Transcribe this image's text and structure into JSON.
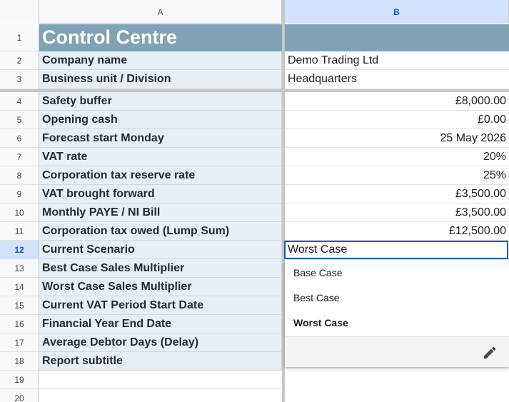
{
  "columns": {
    "a": "A",
    "b": "B"
  },
  "rows": [
    {
      "num": "1",
      "label": "Control Centre",
      "value": ""
    },
    {
      "num": "2",
      "label": "Company name",
      "value": "Demo Trading Ltd"
    },
    {
      "num": "3",
      "label": "Business unit / Division",
      "value": "Headquarters"
    },
    {
      "num": "4",
      "label": "Safety buffer",
      "value": "£8,000.00"
    },
    {
      "num": "5",
      "label": "Opening cash",
      "value": "£0.00"
    },
    {
      "num": "6",
      "label": "Forecast start Monday",
      "value": "25 May 2026"
    },
    {
      "num": "7",
      "label": "VAT rate",
      "value": "20%"
    },
    {
      "num": "8",
      "label": "Corporation tax reserve rate",
      "value": "25%"
    },
    {
      "num": "9",
      "label": "VAT brought forward",
      "value": "£3,500.00"
    },
    {
      "num": "10",
      "label": "Monthly PAYE / NI Bill",
      "value": "£3,500.00"
    },
    {
      "num": "11",
      "label": "Corporation tax owed (Lump Sum)",
      "value": "£12,500.00"
    },
    {
      "num": "12",
      "label": "Current Scenario",
      "value": "Worst Case"
    },
    {
      "num": "13",
      "label": "Best Case Sales Multiplier",
      "value": ""
    },
    {
      "num": "14",
      "label": "Worst Case Sales Multiplier",
      "value": ""
    },
    {
      "num": "15",
      "label": "Current VAT Period Start Date",
      "value": ""
    },
    {
      "num": "16",
      "label": "Financial Year End Date",
      "value": ""
    },
    {
      "num": "17",
      "label": "Average Debtor Days (Delay)",
      "value": ""
    },
    {
      "num": "18",
      "label": "Report subtitle",
      "value": ""
    },
    {
      "num": "19",
      "label": "",
      "value": ""
    },
    {
      "num": "20",
      "label": "",
      "value": ""
    }
  ],
  "dropdown": {
    "options": [
      "Base Case",
      "Best Case",
      "Worst Case"
    ],
    "selected": "Worst Case",
    "edit_icon": "pencil-icon"
  },
  "colors": {
    "title_fill": "#7fa3b5",
    "label_fill": "#e8eff4",
    "selection": "#0b57d0"
  }
}
